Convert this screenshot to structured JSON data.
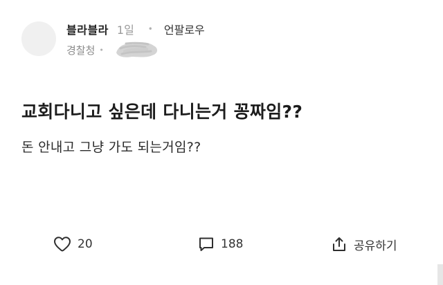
{
  "header": {
    "author_name": "블라블라",
    "time_ago": "1일",
    "separator": "•",
    "unfollow_label": "언팔로우",
    "organization": "경찰청",
    "meta_separator": "•"
  },
  "post": {
    "title": "교회다니고 싶은데 다니는거 꽁짜임??",
    "body": "돈 안내고 그냥 가도 되는거임??"
  },
  "actions": {
    "like_count": "20",
    "comment_count": "188",
    "share_label": "공유하기"
  },
  "icons": {
    "like": "heart-icon",
    "comment": "speech-bubble-icon",
    "share": "share-icon"
  },
  "colors": {
    "text_primary": "#1c1c1c",
    "text_muted": "#9a9a9a",
    "avatar_bg": "#f0f0f0"
  }
}
